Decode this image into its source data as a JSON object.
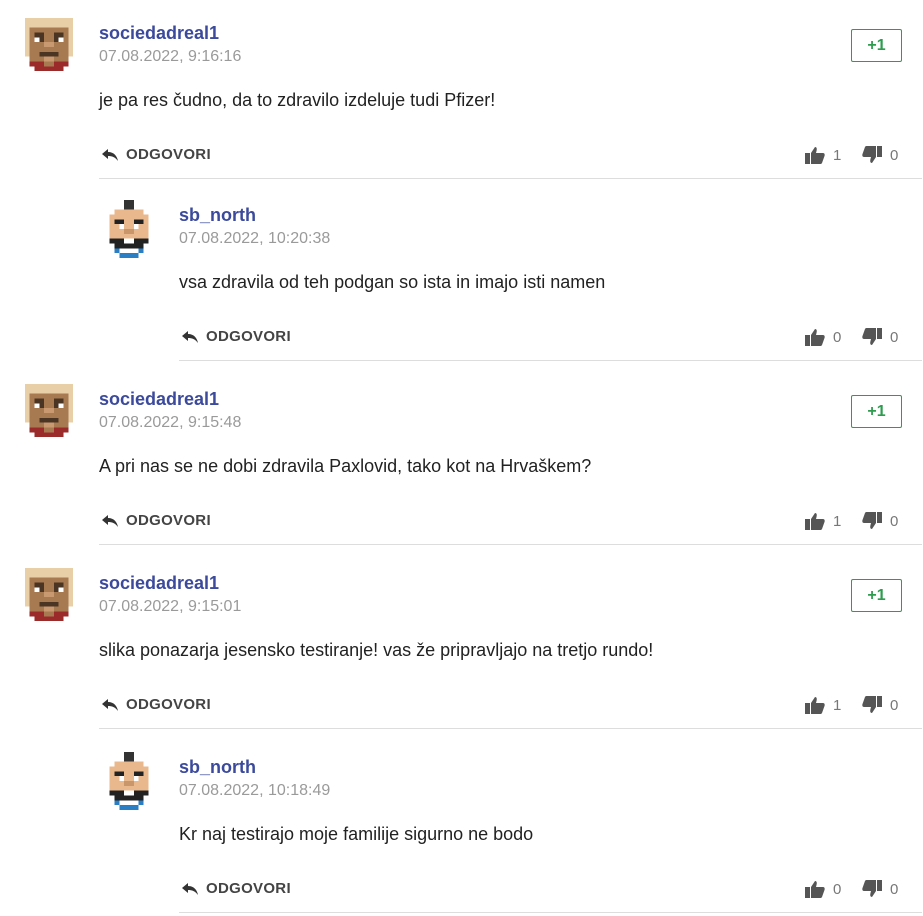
{
  "labels": {
    "reply": "ODGOVORI",
    "plus_one": "+1"
  },
  "icons": {
    "reply": "reply-arrow-icon",
    "upvote": "thumbs-up-icon",
    "downvote": "thumbs-down-icon",
    "avatar_sociedad": "pixel-avatar-bearded-man",
    "avatar_sb": "pixel-avatar-topknot-man"
  },
  "colors": {
    "author": "#3b4a9c",
    "plus_one": "#2e9c4e",
    "date": "#9a9a9a"
  },
  "comments": [
    {
      "author": "sociedadreal1",
      "date": "07.08.2022, 9:16:16",
      "text": "je pa res čudno, da to zdravilo izdeluje tudi Pfizer!",
      "upvotes": "1",
      "downvotes": "0"
    },
    {
      "author": "sb_north",
      "date": "07.08.2022, 10:20:38",
      "text": "vsa zdravila od teh podgan so ista in imajo isti namen",
      "upvotes": "0",
      "downvotes": "0"
    },
    {
      "author": "sociedadreal1",
      "date": "07.08.2022, 9:15:48",
      "text": "A pri nas se ne dobi zdravila Paxlovid, tako kot na Hrvaškem?",
      "upvotes": "1",
      "downvotes": "0"
    },
    {
      "author": "sociedadreal1",
      "date": "07.08.2022, 9:15:01",
      "text": "slika ponazarja jesensko testiranje! vas že pripravljajo na tretjo rundo!",
      "upvotes": "1",
      "downvotes": "0"
    },
    {
      "author": "sb_north",
      "date": "07.08.2022, 10:18:49",
      "text": "Kr naj testirajo moje familije sigurno ne bodo",
      "upvotes": "0",
      "downvotes": "0"
    }
  ]
}
